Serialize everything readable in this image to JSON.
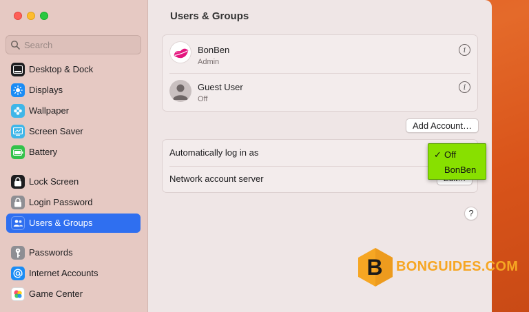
{
  "window": {
    "sidebar": {
      "search": {
        "placeholder": "Search",
        "value": ""
      },
      "items": [
        {
          "label": "Desktop & Dock",
          "icon": "desktop-dock-icon",
          "color": "#1d1d1f"
        },
        {
          "label": "Displays",
          "icon": "displays-icon",
          "color": "#1a8cf5"
        },
        {
          "label": "Wallpaper",
          "icon": "wallpaper-icon",
          "color": "#3fb6e8"
        },
        {
          "label": "Screen Saver",
          "icon": "screen-saver-icon",
          "color": "#3fb6e8"
        },
        {
          "label": "Battery",
          "icon": "battery-icon",
          "color": "#32c24a"
        },
        {
          "label": "Lock Screen",
          "icon": "lock-screen-icon",
          "color": "#1d1d1f"
        },
        {
          "label": "Login Password",
          "icon": "login-password-icon",
          "color": "#8e8e93"
        },
        {
          "label": "Users & Groups",
          "icon": "users-groups-icon",
          "color": "#2f6ff0",
          "selected": true
        },
        {
          "label": "Passwords",
          "icon": "passwords-icon",
          "color": "#8e8e93"
        },
        {
          "label": "Internet Accounts",
          "icon": "internet-accounts-icon",
          "color": "#1a8cf5"
        },
        {
          "label": "Game Center",
          "icon": "game-center-icon",
          "color": "#ffffff"
        }
      ]
    },
    "main": {
      "title": "Users & Groups",
      "users": [
        {
          "name": "BonBen",
          "role": "Admin",
          "avatar": "lips-avatar"
        },
        {
          "name": "Guest User",
          "role": "Off",
          "avatar": "guest-avatar"
        }
      ],
      "add_account_label": "Add Account…",
      "settings": {
        "auto_login_label": "Automatically log in as",
        "network_server_label": "Network account server",
        "edit_label": "Edit…"
      },
      "auto_login_menu": {
        "options": [
          "Off",
          "BonBen"
        ],
        "selected": "Off",
        "check": "✓"
      },
      "help_label": "?"
    }
  },
  "watermark": {
    "letter": "B",
    "text": "BONGUIDES.COM",
    "color": "#f6a623"
  }
}
